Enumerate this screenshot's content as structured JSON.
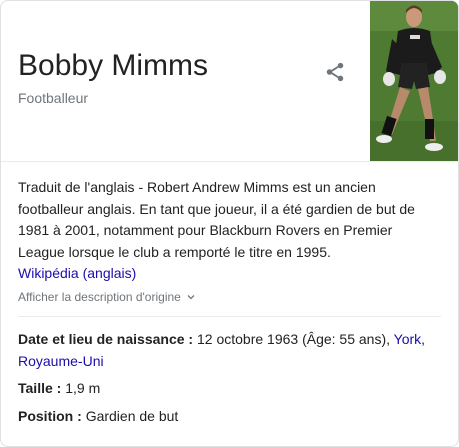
{
  "header": {
    "title": "Bobby Mimms",
    "subtitle": "Footballeur"
  },
  "share_icon": "share-icon",
  "description": {
    "text": "Traduit de l'anglais - Robert Andrew Mimms est un ancien footballeur anglais. En tant que joueur, il a été gardien de but de 1981 à 2001, notamment pour Blackburn Rovers en Premier League lorsque le club a remporté le titre en 1995.",
    "source_link": "Wikipédia (anglais)"
  },
  "show_original": "Afficher la description d'origine",
  "facts": [
    {
      "label": "Date et lieu de naissance",
      "sep": " : ",
      "value": "12 octobre 1963 (Âge: 55 ans), ",
      "link": "York, Royaume-Uni"
    },
    {
      "label": "Taille",
      "sep": " : ",
      "value": "1,9 m"
    },
    {
      "label": "Position",
      "sep": " : ",
      "value": "Gardien de but"
    }
  ],
  "colors": {
    "link": "#1a0dab",
    "secondary_text": "#70757a",
    "text": "#222222",
    "border": "#dfe1e5"
  }
}
